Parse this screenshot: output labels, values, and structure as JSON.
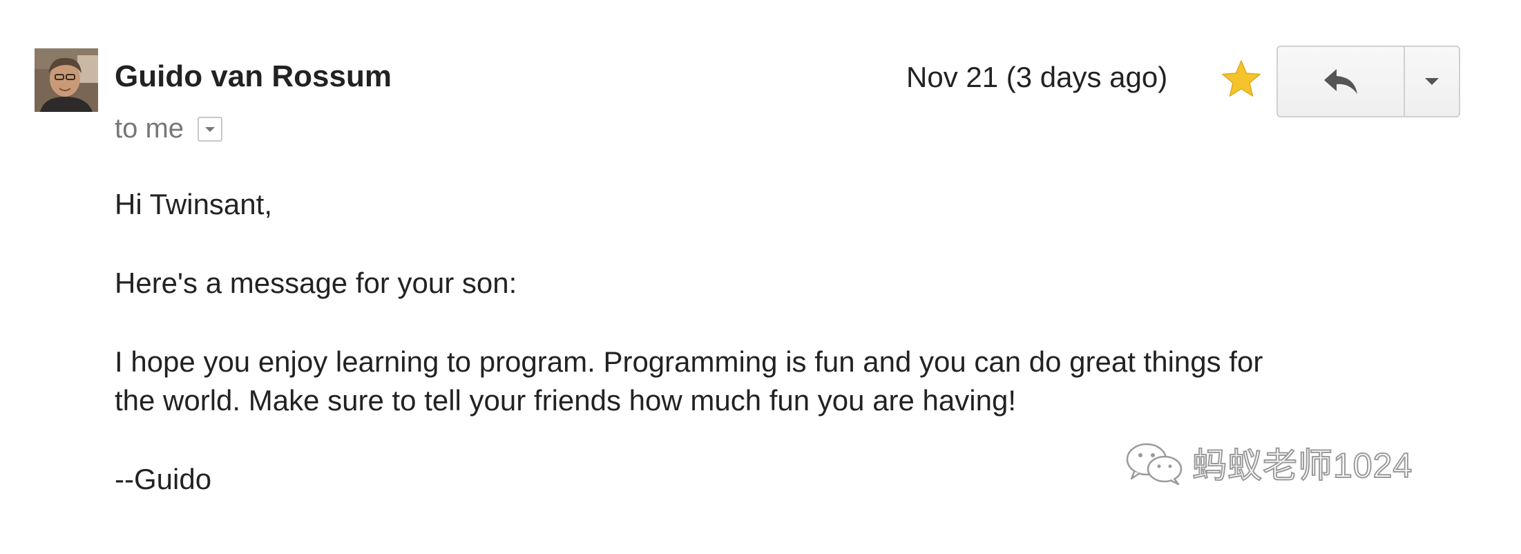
{
  "email": {
    "sender": {
      "name": "Guido van Rossum",
      "avatar_icon": "person-avatar"
    },
    "recipient": {
      "text": "to me",
      "details_icon": "caret-down-icon"
    },
    "date": "Nov 21 (3 days ago)",
    "star": {
      "icon": "star-icon",
      "color": "#f5c32c"
    },
    "actions": {
      "reply_icon": "reply-icon",
      "more_icon": "caret-down-icon"
    },
    "body": {
      "greeting": "Hi Twinsant,",
      "intro": "Here's a message for your son:",
      "message_line1": "I hope you enjoy learning to program. Programming is fun and you can do great things for",
      "message_line2": "the world. Make sure to tell your friends how much fun you are having!",
      "signature": "--Guido"
    }
  },
  "watermark": {
    "icon": "wechat-icon",
    "text": "蚂蚁老师1024"
  }
}
